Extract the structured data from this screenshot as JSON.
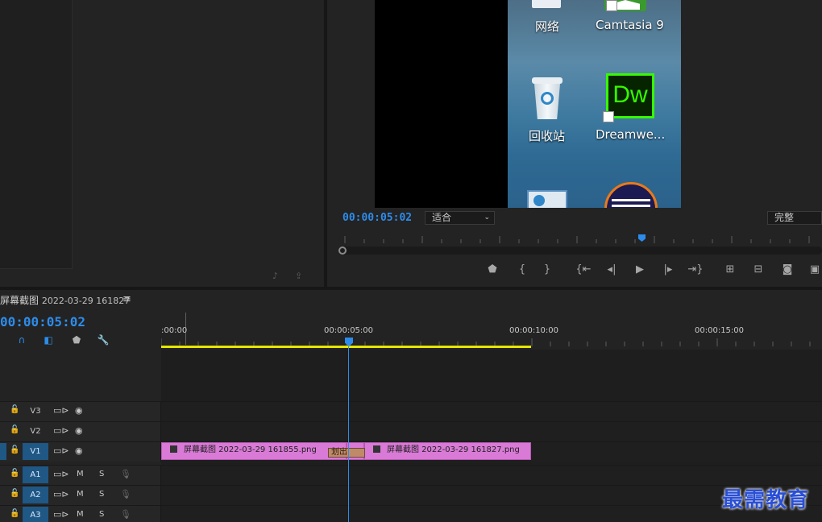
{
  "program_monitor": {
    "timecode": "00:00:05:02",
    "fit_value": "适合",
    "quality_value": "完整",
    "playhead_fraction": 0.62,
    "desktop_icons": [
      {
        "label": "网络",
        "icon": "network-icon"
      },
      {
        "label": "Camtasia 9",
        "icon": "camtasia-icon"
      },
      {
        "label": "回收站",
        "icon": "recycle-bin-icon"
      },
      {
        "label": "Dreamwe...",
        "icon": "dreamweaver-icon"
      }
    ],
    "dreamweaver_badge": "Dw"
  },
  "sequence": {
    "title": "屏幕截图",
    "title_date": "2022-03-29 161827",
    "menu_icon": "≡",
    "timecode": "00:00:05:02"
  },
  "ruler": {
    "labels": [
      ":00:00",
      "00:00:05:00",
      "00:00:10:00",
      "00:00:15:00"
    ]
  },
  "tracks": [
    {
      "name": "V3",
      "type": "video",
      "target": false
    },
    {
      "name": "V2",
      "type": "video",
      "target": false
    },
    {
      "name": "V1",
      "type": "video",
      "target": true
    },
    {
      "name": "A1",
      "type": "audio",
      "target": true,
      "mute_label": "M",
      "solo_label": "S"
    },
    {
      "name": "A2",
      "type": "audio",
      "target": true,
      "mute_label": "M",
      "solo_label": "S"
    },
    {
      "name": "A3",
      "type": "audio",
      "target": true,
      "mute_label": "M",
      "solo_label": "S"
    }
  ],
  "clips": [
    {
      "label": "屏幕截图  2022-03-29  161855.png"
    },
    {
      "label": "屏幕截图  2022-03-29  161827.png"
    }
  ],
  "transition_label": "划出",
  "watermark": "最需教育",
  "colors": {
    "accent_blue": "#2d8ceb",
    "clip_pink": "#d97ad6",
    "work_area_yellow": "#e6e600",
    "target_blue": "#1f5785"
  }
}
